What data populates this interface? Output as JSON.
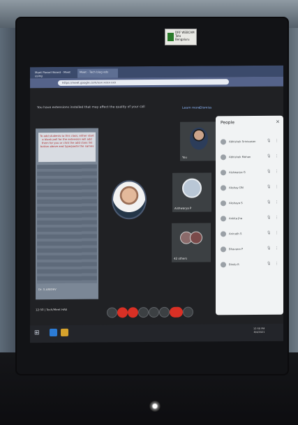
{
  "webcam_sticker": {
    "line1": "DRF WEBCAM",
    "line2": "Tata Bengaluru"
  },
  "browser": {
    "tabs": [
      "Meet Parent Board - Meet using",
      "Meet - Tech blog eds"
    ],
    "url": "https://meet.google.com/xxx-xxxx-xxx"
  },
  "meeting": {
    "notice": "You have extensions installed that may affect the quality of your call",
    "learn_more": "Learn more",
    "dismiss": "Dismiss",
    "slide_caption": "To add students to this class, either start a blank poll for the extension will add them for you or click the add class list button above and type/paste the names",
    "presenter_label": "Dr. S.ARIDEV",
    "bottom_label": "12:50  |  Tech/Meet HAE",
    "tiles": {
      "you": "You",
      "second": "Aishwarya P",
      "others": "42 others"
    }
  },
  "people_panel": {
    "title": "People",
    "close": "✕",
    "members": [
      "Abhishek Srinivasan",
      "Abhishek Mohan",
      "Aishwarya G",
      "Akshay DN",
      "Akshaya S",
      "Ankita Jha",
      "Anirudh S",
      "Bhavana P",
      "Bindu R"
    ]
  },
  "taskbar": {
    "time": "12:50 PM",
    "date": "8/4/2021"
  },
  "colors": {
    "accent": "#8ab4f8",
    "end_call": "#d93025",
    "panel_bg": "#f1f3f4"
  }
}
